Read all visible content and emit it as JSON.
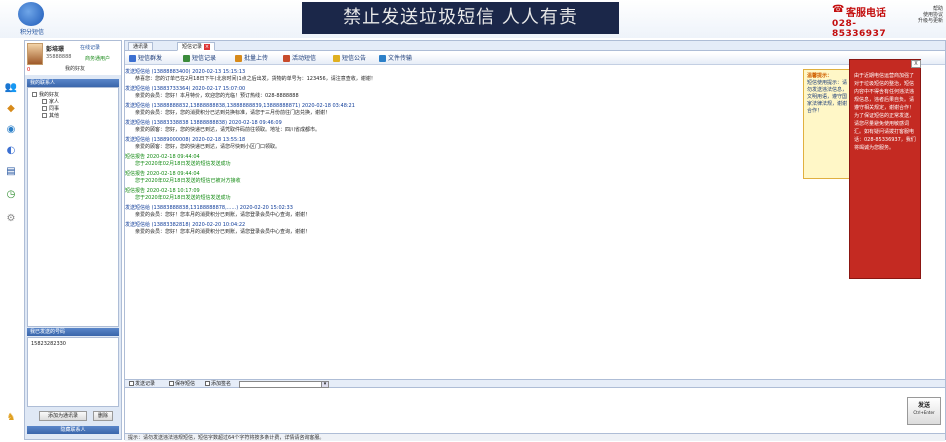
{
  "header": {
    "logo_text": "积分短信",
    "banner": "禁止发送垃圾短信   人人有责",
    "hotline_label": "客服电话",
    "hotline_number": "028-85336937",
    "links": [
      "帮助",
      "使用协议",
      "升级与更新"
    ]
  },
  "user": {
    "name": "彭培璟",
    "id": "35888888",
    "status": "隐身",
    "balance_label": "商务通用户",
    "account": "商务通用户",
    "online_btn": "在线记录",
    "small_count": "0",
    "friends": "0",
    "friends_label": "我的好友"
  },
  "contacts": {
    "header": "我的联系人",
    "items": [
      "我的好友",
      "家人",
      "同事",
      "其他"
    ]
  },
  "sent": {
    "header": "我已发送的号码",
    "number": "15823282330",
    "btn_save": "添加为通讯录",
    "btn_del": "删除",
    "footer": "隐藏联系人"
  },
  "tabs": [
    {
      "label": "通讯录"
    },
    {
      "label": "短信记录"
    }
  ],
  "toolbar": [
    {
      "label": "短信群发",
      "color": "#3b6fd1"
    },
    {
      "label": "短信记录",
      "color": "#3b8b3b"
    },
    {
      "label": "批量上传",
      "color": "#d78a1a"
    },
    {
      "label": "活动短信",
      "color": "#c84b2b"
    },
    {
      "label": "短信公告",
      "color": "#e0b020"
    },
    {
      "label": "文件传输",
      "color": "#2b7fc8"
    }
  ],
  "messages": [
    {
      "hd": "发送短信给 (13888883400)  2020-02-13 15:15:13",
      "body": "恭喜您：您的订单已在2月18日下午(北京时间)1点之后出发，货物的单号为：123456，请注意查收，谢谢！",
      "green": false
    },
    {
      "hd": "发送短信给 (13883733364) 2020-02-17 15:07:00",
      "body": "亲爱的会员：您好！本月特价，欢迎您的光临！预订热线：028-8888888",
      "green": false
    },
    {
      "hd": "发送短信给 (13888888832,13888888838,13888888839,13888888871) 2020-02-18 03:48:21",
      "body": "亲爱的会员：您好，您的消费积分已达到兑换标准，请您于三月份前往门店兑换，谢谢！",
      "green": false
    },
    {
      "hd": "发送短信给 (13883338838 13888888838) 2020-02-18 09:46:09",
      "body": "亲爱的顾客：您好，您的快递已到达，请凭取件码前往领取。地址：四川省成都市。",
      "green": false
    },
    {
      "hd": "发送短信给 (13889000008) 2020-02-18 13:55:18",
      "body": "亲爱的顾客：您好，您的快递已到达，请您尽快到小区门口领取。",
      "green": false
    },
    {
      "hd": "短信报告 2020-02-18 09:44:04",
      "body": "您于2020年02月18日发送的短信发送成功",
      "green": true
    },
    {
      "hd": "短信报告 2020-02-18 09:44:04",
      "body": "您于2020年02月18日发送的短信已被对方接收",
      "green": true
    },
    {
      "hd": "短信报告 2020-02-18 10:17:09",
      "body": "您于2020年02月18日发送的短信发送成功",
      "green": true
    },
    {
      "hd": "发送短信给 (13883888838,13188888878,......) 2020-02-20 15:02:33",
      "body": "亲爱的会员：您好！您本月的消费积分已到账，请您登录会员中心查询，谢谢！",
      "green": false
    },
    {
      "hd": "发送短信给 (13883382818) 2020-02-20 10:04:22",
      "body": "亲爱的会员：您好！您本月的消费积分已到账，请您登录会员中心查询，谢谢！",
      "green": false
    }
  ],
  "tip": {
    "title": "温馨提示：",
    "body": "短信使用提示：请勿发送违法信息，文明用语，遵守国家法律法规，谢谢合作！"
  },
  "redpanel": {
    "close": "X",
    "text": "由于近期电信运营商加强了对于垃圾短信的整治，短信内容中不得含有任何违法违规信息，违者后果自负。请遵守相关规定，谢谢合作！为了保证短信的正常发送，请您尽量避免使用敏感词汇。如有疑问请拨打客服电话：028-85336937，我们将竭诚为您服务。"
  },
  "inputbar": {
    "opt1": "发送记录",
    "opt2": "保存短信",
    "opt3": "添加签名"
  },
  "send_button": {
    "label": "发送",
    "hint": "Ctrl+Enter"
  },
  "status": "提示：请勿发送违法违规短信，短信字数超过64个字符将按多条计费，详情请咨询客服。"
}
